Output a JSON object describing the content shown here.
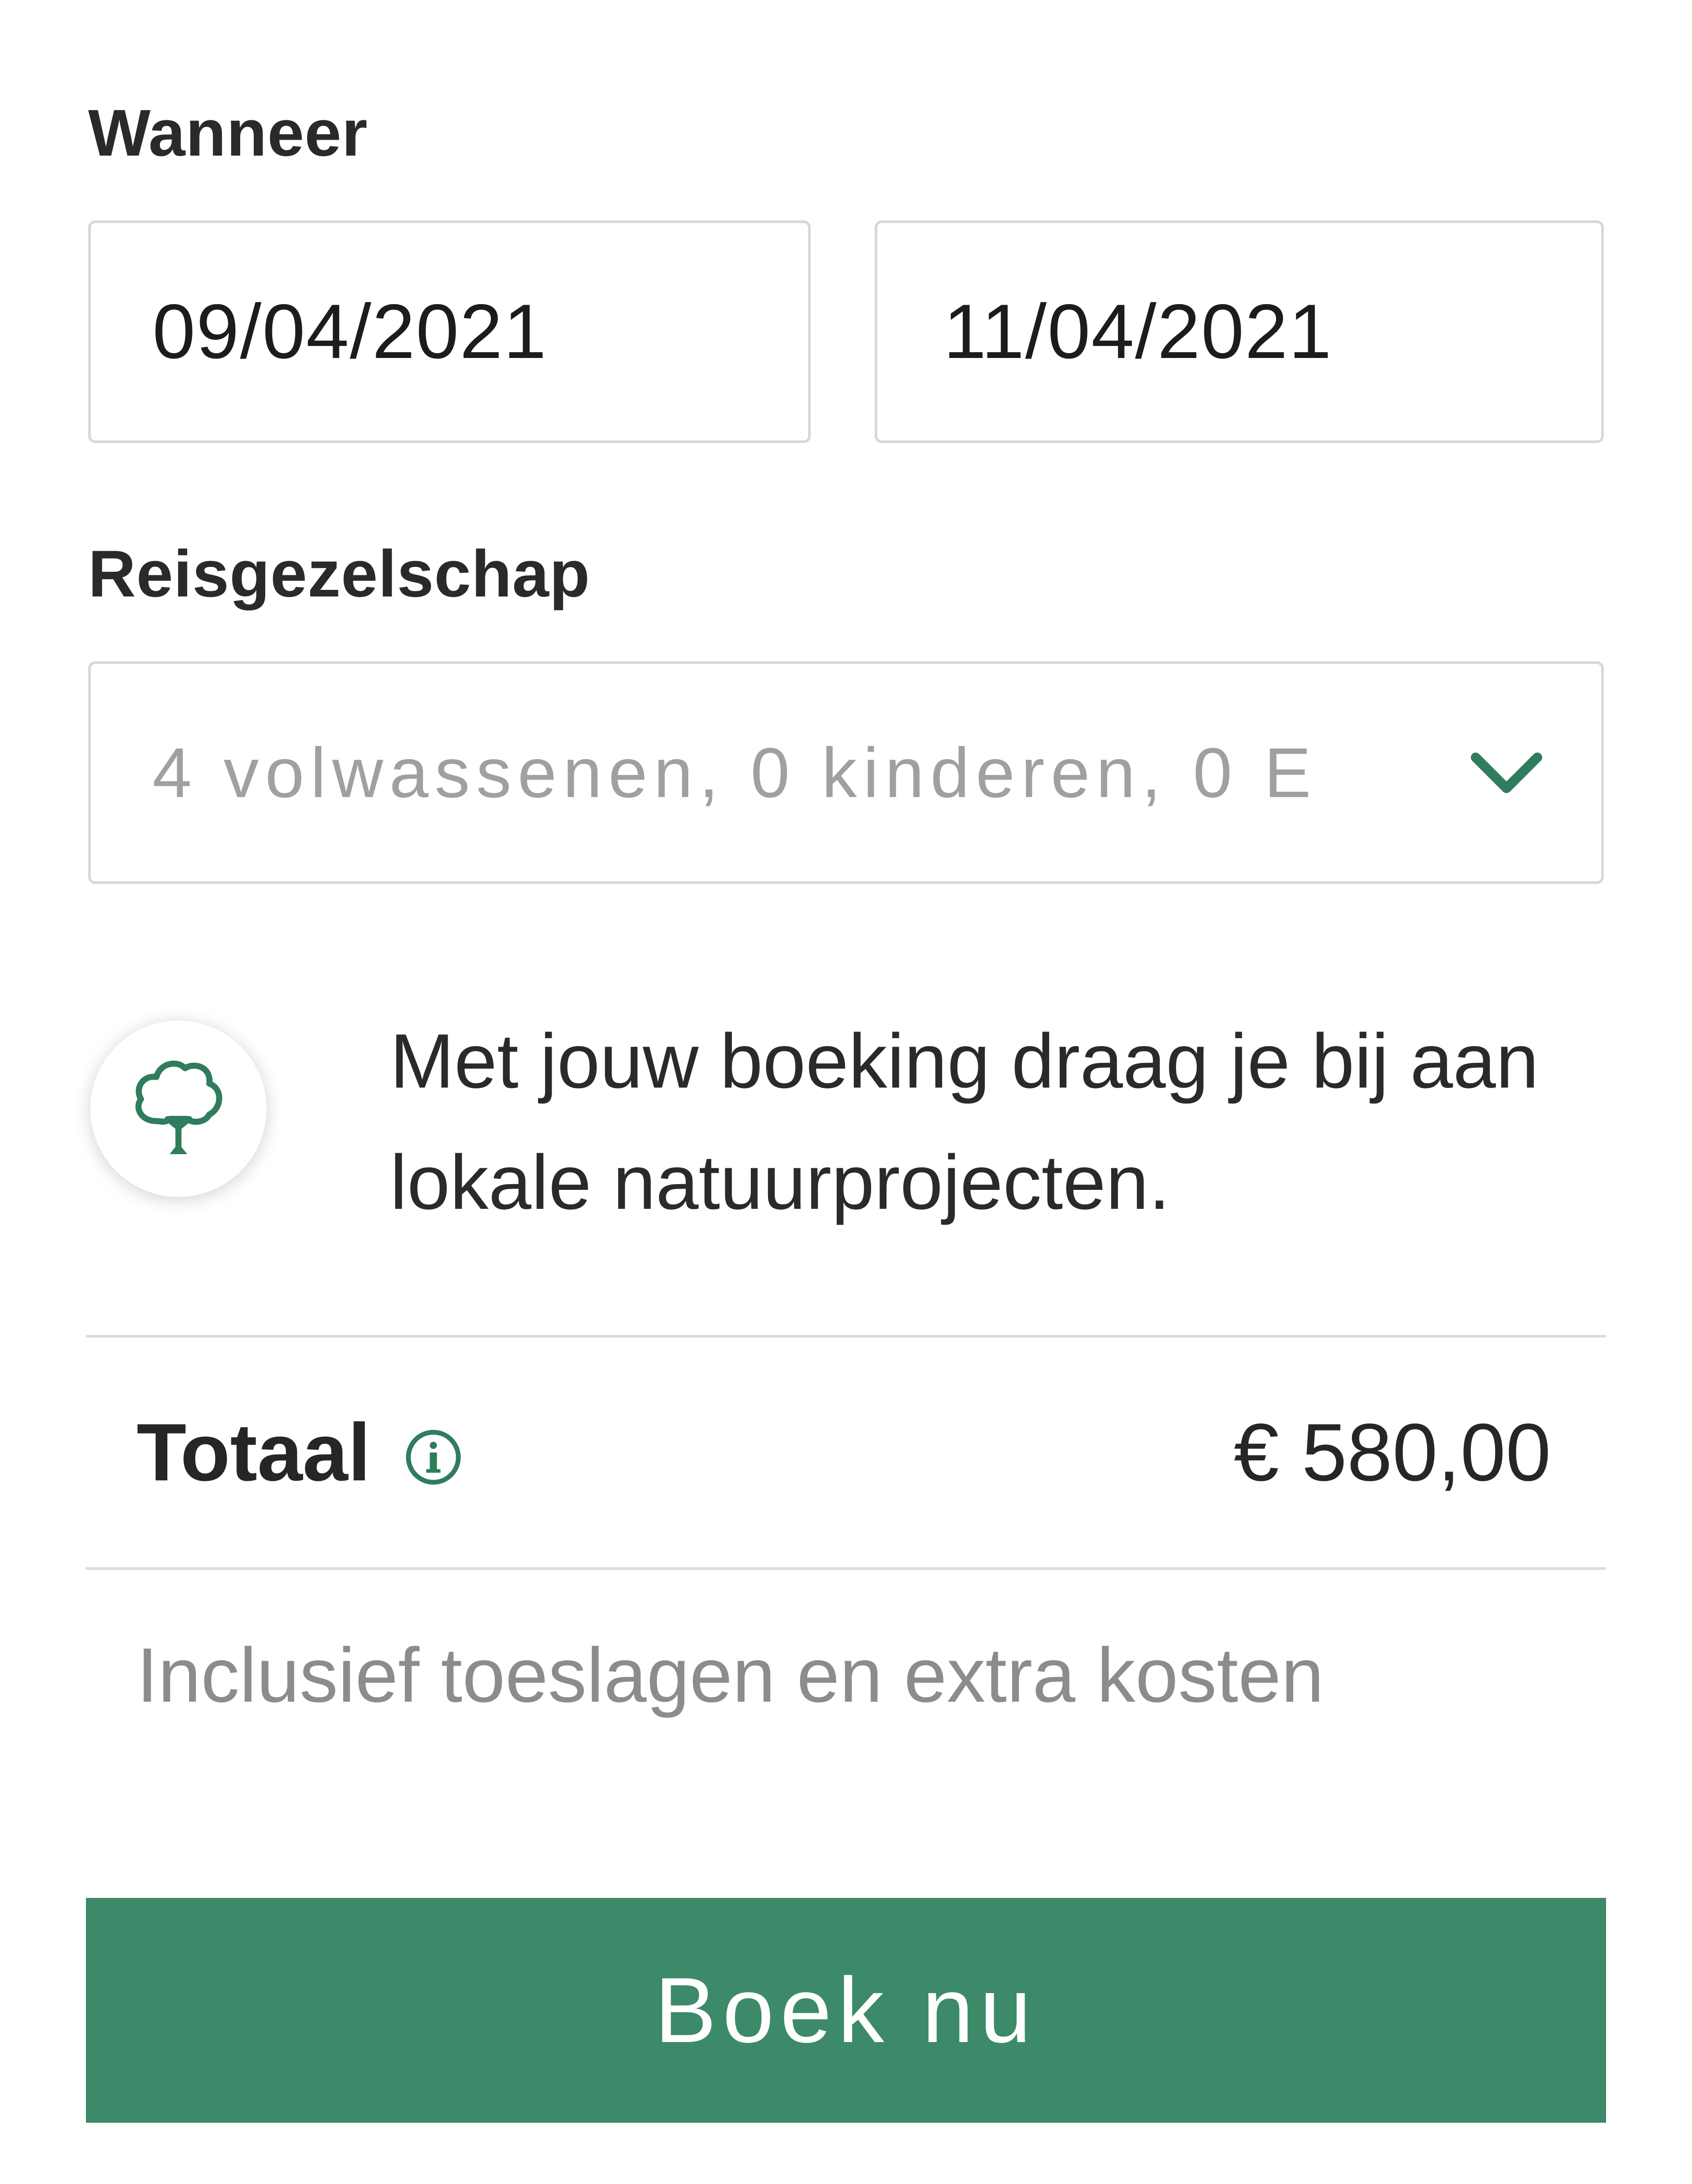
{
  "when": {
    "label": "Wanneer",
    "start_date": "09/04/2021",
    "end_date": "11/04/2021"
  },
  "company": {
    "label": "Reisgezelschap",
    "value": "4 volwassenen, 0 kinderen, 0 E",
    "chevron_icon": "chevron-down-icon"
  },
  "eco": {
    "icon": "tree-icon",
    "text": "Met jouw boeking draag je bij aan lokale natuurprojecten."
  },
  "total": {
    "label": "Totaal",
    "info_icon": "info-icon",
    "price": "€ 580,00",
    "note": "Inclusief toeslagen en extra kosten"
  },
  "cta": {
    "label": "Boek nu"
  },
  "colors": {
    "brand_green": "#3c8a6a",
    "icon_green": "#2f7d5c"
  }
}
